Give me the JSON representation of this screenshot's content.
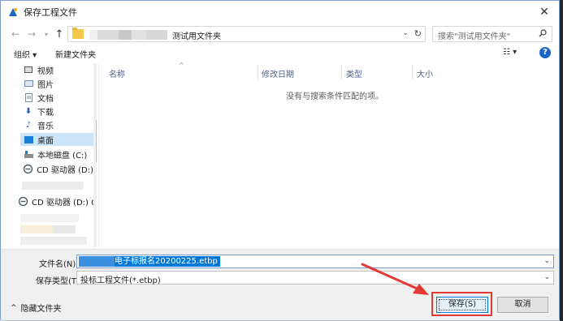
{
  "window": {
    "title": "保存工程文件",
    "close_symbol": "✕"
  },
  "address": {
    "current_folder": "测试用文件夹",
    "search_placeholder": "搜索\"测试用文件夹\""
  },
  "toolbar": {
    "organize": "组织 ▾",
    "new_folder": "新建文件夹",
    "view_symbol": "☷ ▾",
    "help_symbol": "?"
  },
  "nav_pane": {
    "items": [
      {
        "label": "视频",
        "icon": "video-icon"
      },
      {
        "label": "图片",
        "icon": "picture-icon"
      },
      {
        "label": "文档",
        "icon": "document-icon"
      },
      {
        "label": "下载",
        "icon": "download-icon"
      },
      {
        "label": "音乐",
        "icon": "music-icon"
      },
      {
        "label": "桌面",
        "icon": "desktop-icon"
      },
      {
        "label": "本地磁盘 (C:)",
        "icon": "drive-icon"
      },
      {
        "label": "CD 驱动器 (D:)",
        "icon": "cd-drive-icon"
      },
      {
        "label": "CD 驱动器 (D:) C",
        "icon": "cd-drive-icon"
      }
    ]
  },
  "file_list": {
    "columns": [
      "名称",
      "修改日期",
      "类型",
      "大小"
    ],
    "empty_message": "没有与搜索条件匹配的项。"
  },
  "fields": {
    "filename_label": "文件名(N):",
    "filename_value": "电子标报名20200225.etbp",
    "filetype_label": "保存类型(T):",
    "filetype_value": "投标工程文件(*.etbp)"
  },
  "footer": {
    "hide_folders": "隐藏文件夹",
    "save": "保存(S)",
    "cancel": "取消"
  },
  "colors": {
    "accent": "#0078d7",
    "annotation": "#e53935"
  }
}
